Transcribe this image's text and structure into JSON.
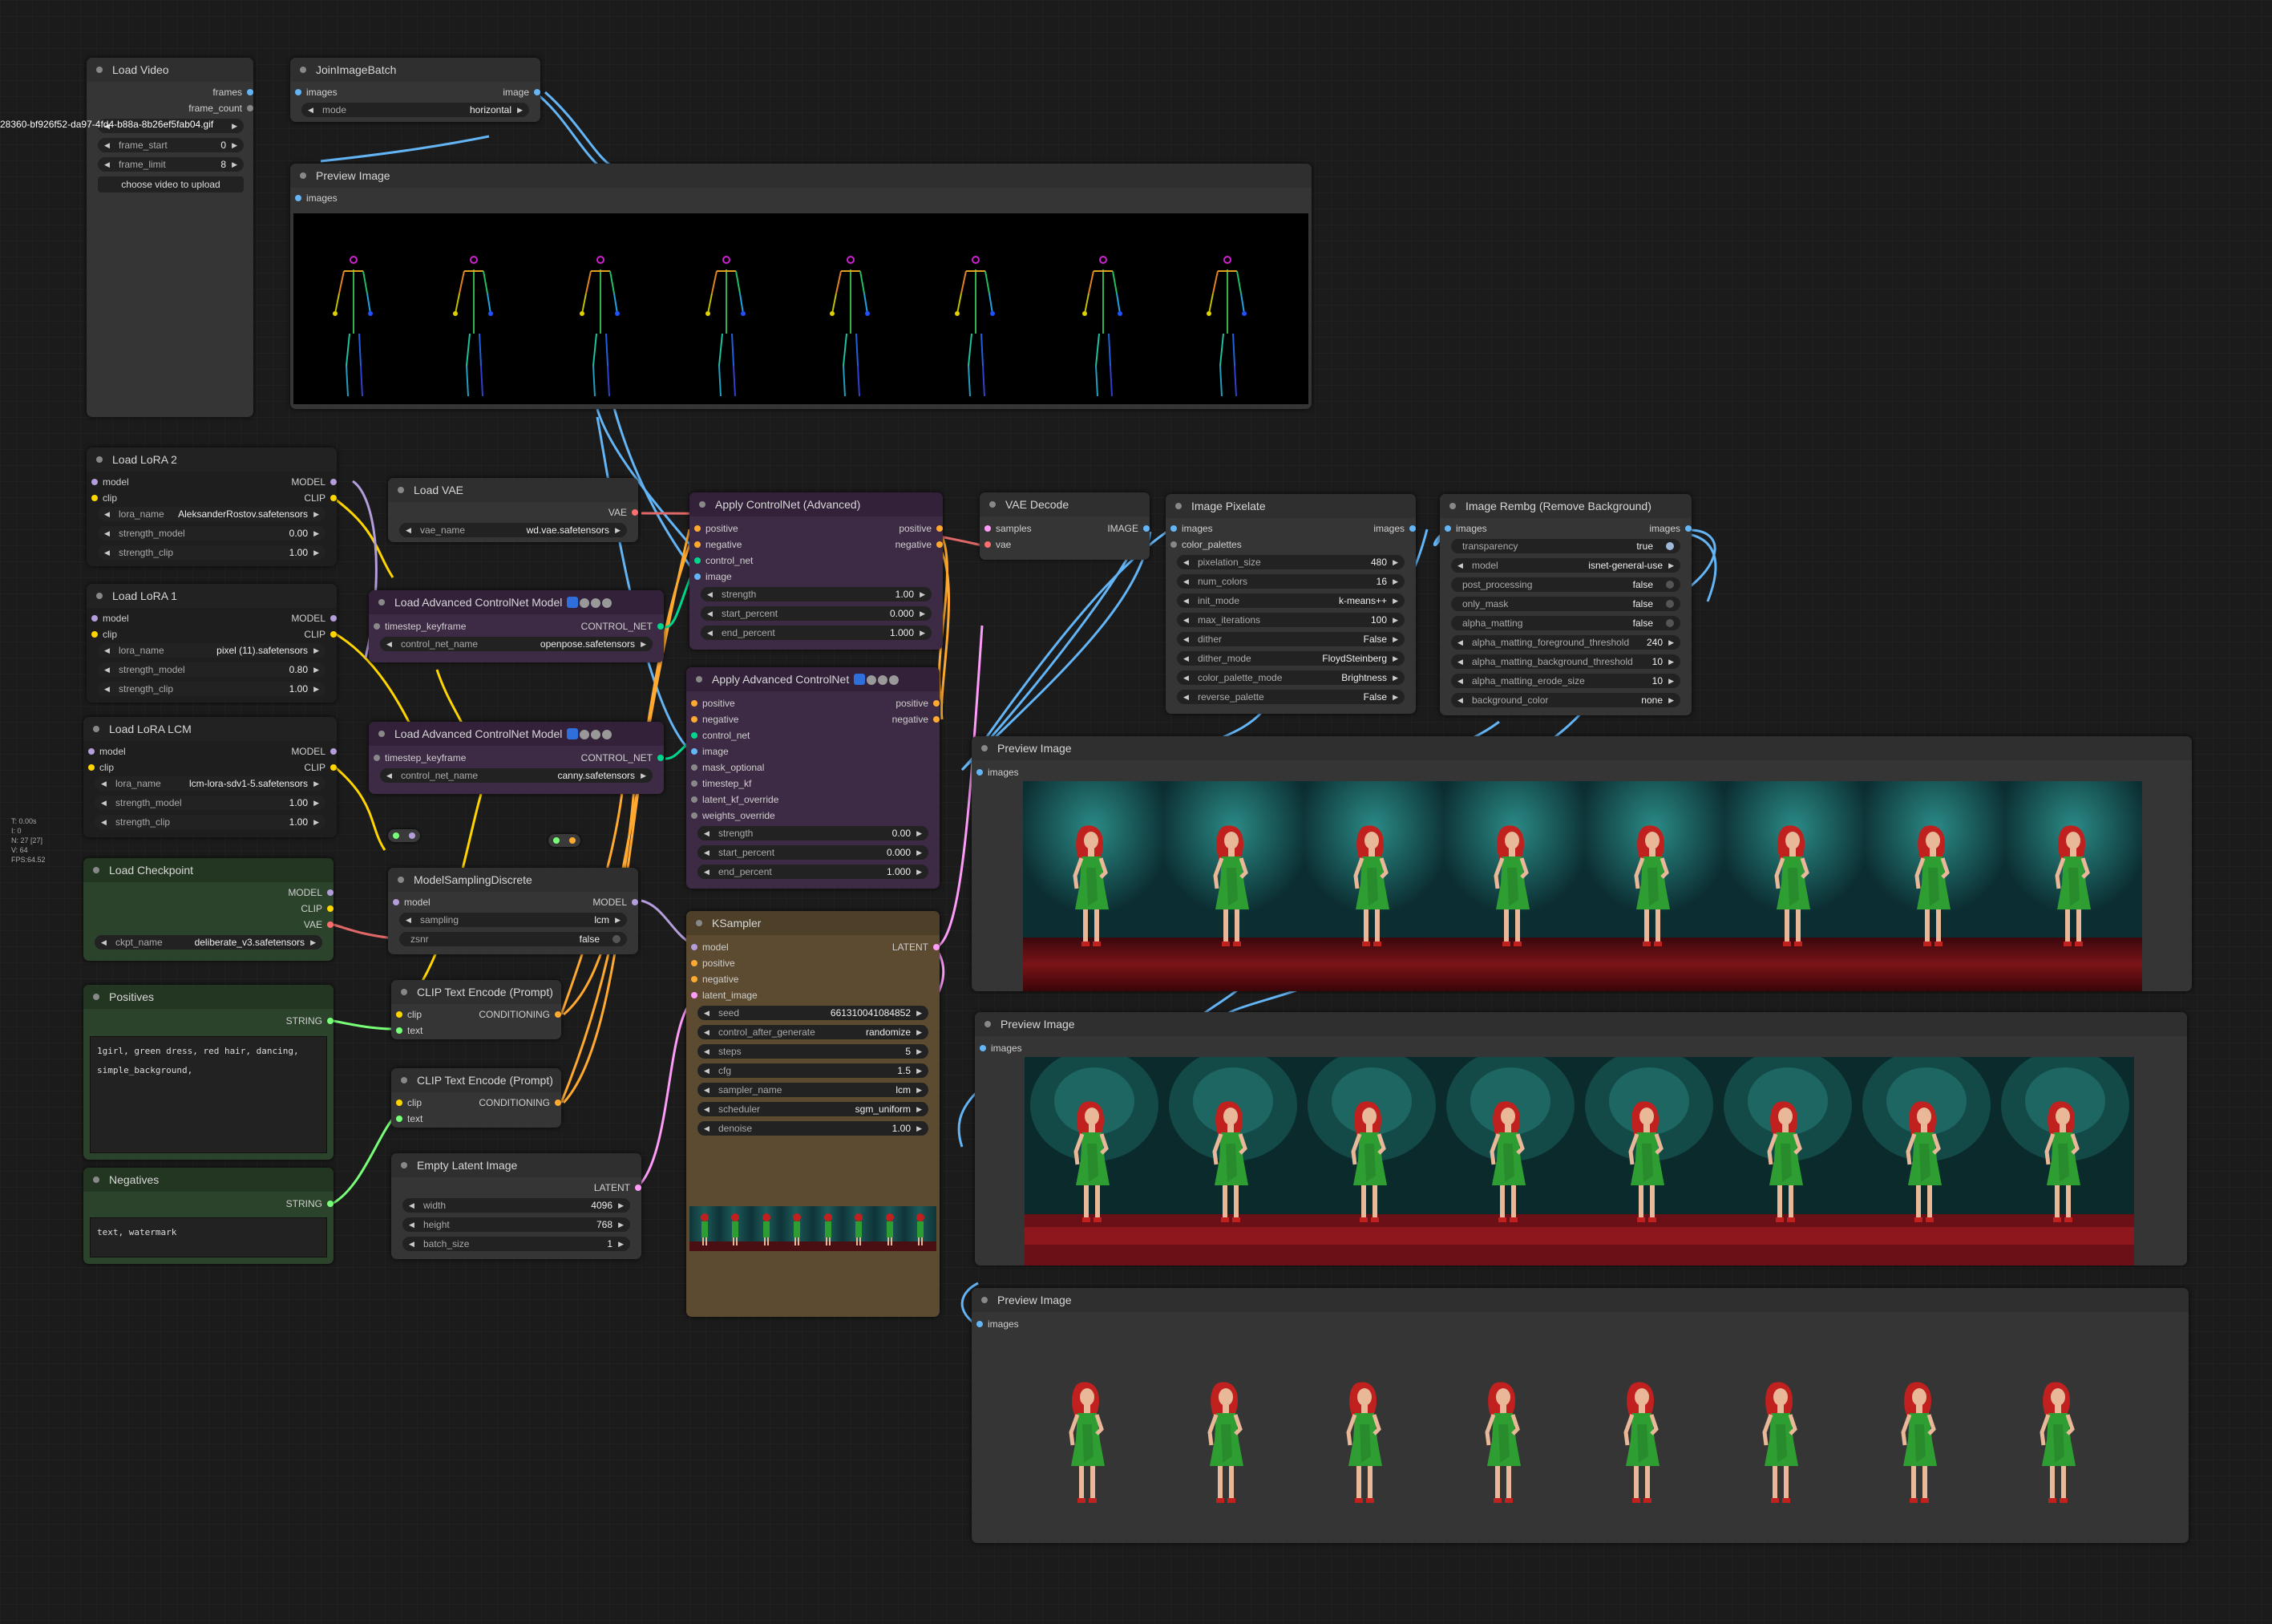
{
  "stats": [
    "T: 0.00s",
    "I: 0",
    "N: 27 [27]",
    "V: 64",
    "FPS:64.52"
  ],
  "overflow_filename": "28360-bf926f52-da97-4fd4-b88a-8b26ef5fab04.gif",
  "colors": {
    "canvas": "#1b1b1b",
    "node": "#353535",
    "controlnet_node": "#3d2a44",
    "text_node": "#2c432b",
    "lora_node": "#1e1e1e",
    "ksampler_node": "#5c4b30",
    "model": "#b39ddb",
    "clip": "#ffd500",
    "vae": "#ff6e6e",
    "image": "#64b5f6",
    "latent": "#ff9cf9",
    "conditioning": "#ffa931",
    "control_net": "#00d78d",
    "string": "#77ff77",
    "green_dress": "#2e9e33",
    "hair": "#c0201e"
  },
  "nodes": {
    "load_video": {
      "title": "Load Video",
      "outputs": [
        "frames",
        "frame_count"
      ],
      "frame_start": {
        "label": "frame_start",
        "value": "0"
      },
      "frame_limit": {
        "label": "frame_limit",
        "value": "8"
      },
      "upload_button": "choose video to upload"
    },
    "join_image_batch": {
      "title": "JoinImageBatch",
      "input": "images",
      "output": "image",
      "mode": {
        "label": "mode",
        "value": "horizontal"
      }
    },
    "preview_pose": {
      "title": "Preview Image",
      "input": "images",
      "frames": 8
    },
    "load_lora_2": {
      "title": "Load LoRA 2",
      "inputs": [
        "model",
        "clip"
      ],
      "outputs": [
        "MODEL",
        "CLIP"
      ],
      "lora_name": {
        "label": "lora_name",
        "value": "AleksanderRostov.safetensors"
      },
      "strength_model": {
        "label": "strength_model",
        "value": "0.00"
      },
      "strength_clip": {
        "label": "strength_clip",
        "value": "1.00"
      }
    },
    "load_lora_1": {
      "title": "Load LoRA 1",
      "inputs": [
        "model",
        "clip"
      ],
      "outputs": [
        "MODEL",
        "CLIP"
      ],
      "lora_name": {
        "label": "lora_name",
        "value": "pixel (11).safetensors"
      },
      "strength_model": {
        "label": "strength_model",
        "value": "0.80"
      },
      "strength_clip": {
        "label": "strength_clip",
        "value": "1.00"
      }
    },
    "load_lora_lcm": {
      "title": "Load LoRA LCM",
      "inputs": [
        "model",
        "clip"
      ],
      "outputs": [
        "MODEL",
        "CLIP"
      ],
      "lora_name": {
        "label": "lora_name",
        "value": "lcm-lora-sdv1-5.safetensors"
      },
      "strength_model": {
        "label": "strength_model",
        "value": "1.00"
      },
      "strength_clip": {
        "label": "strength_clip",
        "value": "1.00"
      }
    },
    "load_checkpoint": {
      "title": "Load Checkpoint",
      "outputs": [
        "MODEL",
        "CLIP",
        "VAE"
      ],
      "ckpt_name": {
        "label": "ckpt_name",
        "value": "deliberate_v3.safetensors"
      }
    },
    "positives": {
      "title": "Positives",
      "output": "STRING",
      "text": "1girl, green dress, red hair, dancing,\nsimple_background,"
    },
    "negatives": {
      "title": "Negatives",
      "output": "STRING",
      "text": "text, watermark"
    },
    "load_vae": {
      "title": "Load VAE",
      "output": "VAE",
      "vae_name": {
        "label": "vae_name",
        "value": "wd.vae.safetensors"
      }
    },
    "load_adv_cn_1": {
      "title": "Load Advanced ControlNet Model",
      "input": "timestep_keyframe",
      "output": "CONTROL_NET",
      "control_net_name": {
        "label": "control_net_name",
        "value": "openpose.safetensors"
      }
    },
    "load_adv_cn_2": {
      "title": "Load Advanced ControlNet Model",
      "input": "timestep_keyframe",
      "output": "CONTROL_NET",
      "control_net_name": {
        "label": "control_net_name",
        "value": "canny.safetensors"
      }
    },
    "model_sampling": {
      "title": "ModelSamplingDiscrete",
      "input": "model",
      "output": "MODEL",
      "sampling": {
        "label": "sampling",
        "value": "lcm"
      },
      "zsnr": {
        "label": "zsnr",
        "value": "false"
      }
    },
    "clip_encode_1": {
      "title": "CLIP Text Encode (Prompt)",
      "inputs": [
        "clip",
        "text"
      ],
      "output": "CONDITIONING"
    },
    "clip_encode_2": {
      "title": "CLIP Text Encode (Prompt)",
      "inputs": [
        "clip",
        "text"
      ],
      "output": "CONDITIONING"
    },
    "empty_latent": {
      "title": "Empty Latent Image",
      "output": "LATENT",
      "width": {
        "label": "width",
        "value": "4096"
      },
      "height": {
        "label": "height",
        "value": "768"
      },
      "batch_size": {
        "label": "batch_size",
        "value": "1"
      }
    },
    "apply_cn_adv": {
      "title": "Apply ControlNet (Advanced)",
      "inputs": [
        "positive",
        "negative",
        "control_net",
        "image"
      ],
      "outputs": [
        "positive",
        "negative"
      ],
      "strength": {
        "label": "strength",
        "value": "1.00"
      },
      "start_percent": {
        "label": "start_percent",
        "value": "0.000"
      },
      "end_percent": {
        "label": "end_percent",
        "value": "1.000"
      }
    },
    "apply_adv_cn": {
      "title": "Apply Advanced ControlNet",
      "inputs": [
        "positive",
        "negative",
        "control_net",
        "image",
        "mask_optional",
        "timestep_kf",
        "latent_kf_override",
        "weights_override"
      ],
      "outputs": [
        "positive",
        "negative"
      ],
      "strength": {
        "label": "strength",
        "value": "0.00"
      },
      "start_percent": {
        "label": "start_percent",
        "value": "0.000"
      },
      "end_percent": {
        "label": "end_percent",
        "value": "1.000"
      }
    },
    "ksampler": {
      "title": "KSampler",
      "inputs": [
        "model",
        "positive",
        "negative",
        "latent_image"
      ],
      "output": "LATENT",
      "widgets": [
        {
          "label": "seed",
          "value": "661310041084852"
        },
        {
          "label": "control_after_generate",
          "value": "randomize"
        },
        {
          "label": "steps",
          "value": "5"
        },
        {
          "label": "cfg",
          "value": "1.5"
        },
        {
          "label": "sampler_name",
          "value": "lcm"
        },
        {
          "label": "scheduler",
          "value": "sgm_uniform"
        },
        {
          "label": "denoise",
          "value": "1.00"
        }
      ]
    },
    "vae_decode": {
      "title": "VAE Decode",
      "inputs": [
        "samples",
        "vae"
      ],
      "output": "IMAGE"
    },
    "image_pixelate": {
      "title": "Image Pixelate",
      "inputs": [
        "images",
        "color_palettes"
      ],
      "output": "images",
      "widgets": [
        {
          "label": "pixelation_size",
          "value": "480"
        },
        {
          "label": "num_colors",
          "value": "16"
        },
        {
          "label": "init_mode",
          "value": "k-means++"
        },
        {
          "label": "max_iterations",
          "value": "100"
        },
        {
          "label": "dither",
          "value": "False"
        },
        {
          "label": "dither_mode",
          "value": "FloydSteinberg"
        },
        {
          "label": "color_palette_mode",
          "value": "Brightness"
        },
        {
          "label": "reverse_palette",
          "value": "False"
        }
      ]
    },
    "image_rembg": {
      "title": "Image Rembg (Remove Background)",
      "input": "images",
      "output": "images",
      "transparency": {
        "label": "transparency",
        "value": "true"
      },
      "model": {
        "label": "model",
        "value": "isnet-general-use"
      },
      "toggles": [
        {
          "label": "post_processing",
          "value": "false"
        },
        {
          "label": "only_mask",
          "value": "false"
        },
        {
          "label": "alpha_matting",
          "value": "false"
        }
      ],
      "widgets": [
        {
          "label": "alpha_matting_foreground_threshold",
          "value": "240"
        },
        {
          "label": "alpha_matting_background_threshold",
          "value": "10"
        },
        {
          "label": "alpha_matting_erode_size",
          "value": "10"
        },
        {
          "label": "background_color",
          "value": "none"
        }
      ]
    },
    "preview_a": {
      "title": "Preview Image",
      "input": "images"
    },
    "preview_b": {
      "title": "Preview Image",
      "input": "images"
    },
    "preview_c": {
      "title": "Preview Image",
      "input": "images"
    }
  }
}
